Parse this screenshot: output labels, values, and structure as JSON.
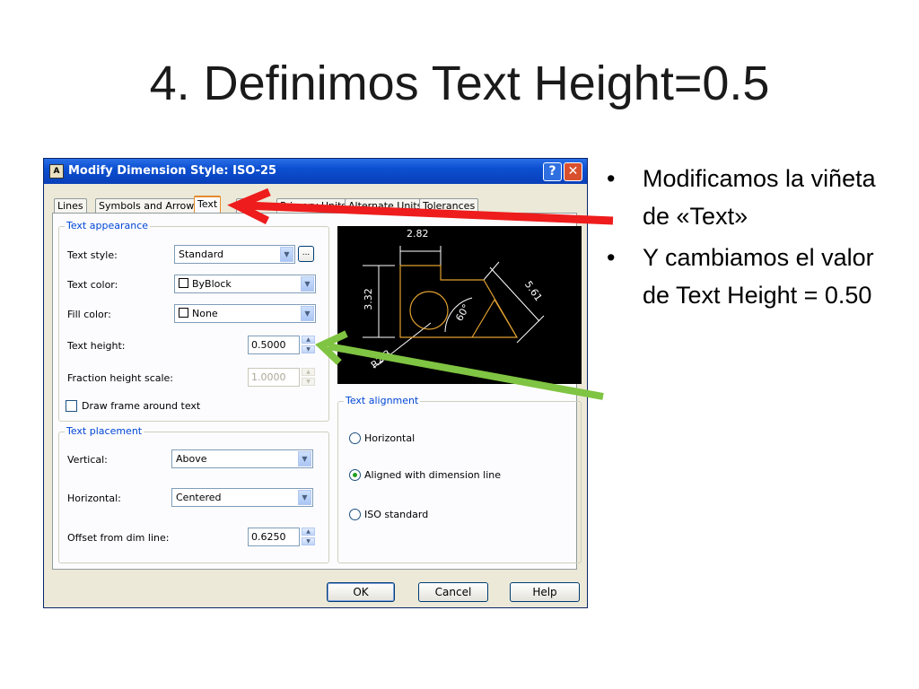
{
  "slide": {
    "title": "4. Definimos Text Height=0.5",
    "bullets": [
      "Modificamos la viñeta de «Text»",
      "Y cambiamos el valor de Text Height = 0.50"
    ]
  },
  "dialog": {
    "title": "Modify Dimension Style: ISO-25",
    "icon_label": "A",
    "help_glyph": "?",
    "close_glyph": "✕",
    "tabs": [
      "Lines",
      "Symbols and Arrows",
      "Text",
      "Fit",
      "Primary Units",
      "Alternate Units",
      "Tolerances"
    ],
    "active_tab": "Text",
    "text_appearance": {
      "legend": "Text appearance",
      "text_style_label": "Text style:",
      "text_style_value": "Standard",
      "ellipsis": "...",
      "text_color_label": "Text color:",
      "text_color_value": "ByBlock",
      "fill_color_label": "Fill color:",
      "fill_color_value": "None",
      "text_height_label": "Text height:",
      "text_height_value": "0.5000",
      "fraction_label": "Fraction height scale:",
      "fraction_value": "1.0000",
      "draw_frame_label": "Draw frame around text",
      "draw_frame_checked": false
    },
    "text_placement": {
      "legend": "Text placement",
      "vertical_label": "Vertical:",
      "vertical_value": "Above",
      "horizontal_label": "Horizontal:",
      "horizontal_value": "Centered",
      "offset_label": "Offset from dim line:",
      "offset_value": "0.6250"
    },
    "text_alignment": {
      "legend": "Text alignment",
      "options": [
        "Horizontal",
        "Aligned with dimension line",
        "ISO standard"
      ],
      "selected": "Aligned with dimension line"
    },
    "preview_labels": {
      "top": "2.82",
      "left": "3.32",
      "right": "5.61",
      "angle": "60°",
      "radius": "R2.3"
    },
    "buttons": {
      "ok": "OK",
      "cancel": "Cancel",
      "help": "Help"
    }
  },
  "colors": {
    "red_arrow": "#ee1c1c",
    "green_arrow": "#7fc442",
    "preview_shape": "#e0a030"
  }
}
